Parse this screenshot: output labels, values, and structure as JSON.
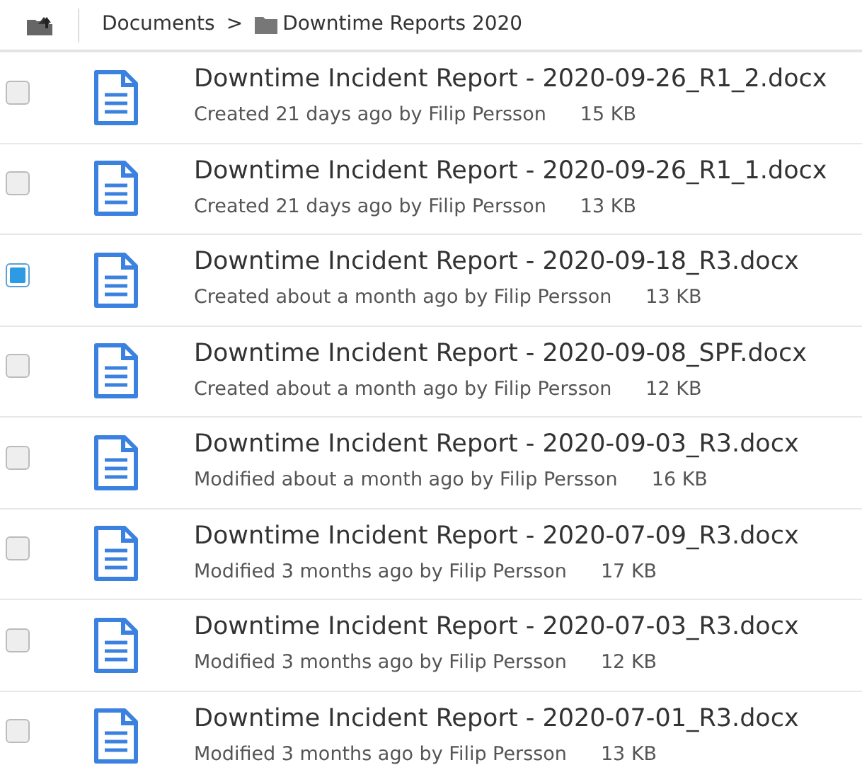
{
  "breadcrumb": {
    "items": [
      "Documents",
      "Downtime Reports 2020"
    ],
    "separator": ">"
  },
  "files": [
    {
      "name": "Downtime Incident Report - 2020-09-26_R1_2.docx",
      "meta": "Created 21 days ago by Filip Persson",
      "size": "15 KB",
      "selected": false
    },
    {
      "name": "Downtime Incident Report - 2020-09-26_R1_1.docx",
      "meta": "Created 21 days ago by Filip Persson",
      "size": "13 KB",
      "selected": false
    },
    {
      "name": "Downtime Incident Report - 2020-09-18_R3.docx",
      "meta": "Created about a month ago by Filip Persson",
      "size": "13 KB",
      "selected": true
    },
    {
      "name": "Downtime Incident Report - 2020-09-08_SPF.docx",
      "meta": "Created about a month ago by Filip Persson",
      "size": "12 KB",
      "selected": false
    },
    {
      "name": "Downtime Incident Report - 2020-09-03_R3.docx",
      "meta": "Modified about a month ago by Filip Persson",
      "size": "16 KB",
      "selected": false
    },
    {
      "name": "Downtime Incident Report - 2020-07-09_R3.docx",
      "meta": "Modified 3 months ago by Filip Persson",
      "size": "17 KB",
      "selected": false
    },
    {
      "name": "Downtime Incident Report - 2020-07-03_R3.docx",
      "meta": "Modified 3 months ago by Filip Persson",
      "size": "12 KB",
      "selected": false
    },
    {
      "name": "Downtime Incident Report - 2020-07-01_R3.docx",
      "meta": "Modified 3 months ago by Filip Persson",
      "size": "13 KB",
      "selected": false
    }
  ]
}
